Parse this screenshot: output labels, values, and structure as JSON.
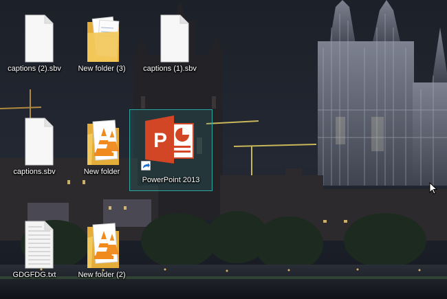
{
  "desktop": {
    "icons": [
      {
        "label": "captions (2).sbv",
        "icon": "blank-document-icon",
        "type": "file"
      },
      {
        "label": "New folder (3)",
        "icon": "folder-documents-icon",
        "type": "folder"
      },
      {
        "label": "captions (1).sbv",
        "icon": "blank-document-icon",
        "type": "file"
      },
      {
        "label": "captions.sbv",
        "icon": "blank-document-icon",
        "type": "file"
      },
      {
        "label": "New folder",
        "icon": "folder-vlc-icon",
        "type": "folder"
      },
      {
        "label": "PowerPoint 2013",
        "icon": "powerpoint-icon",
        "type": "shortcut",
        "selected": true
      },
      {
        "label": "GDGFDG.txt",
        "icon": "text-document-icon",
        "type": "file"
      },
      {
        "label": "New folder (2)",
        "icon": "folder-vlc-icon",
        "type": "folder"
      }
    ]
  },
  "colors": {
    "selection_border": "#2aa7a1",
    "powerpoint_orange": "#d24625",
    "folder_yellow": "#f3c85a",
    "vlc_orange": "#f08a1c"
  }
}
